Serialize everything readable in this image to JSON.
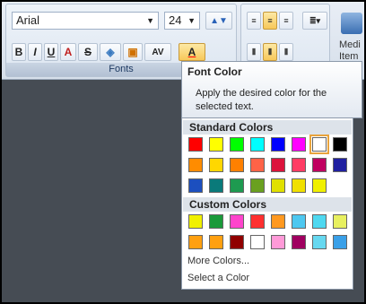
{
  "ribbon": {
    "fonts_group_label": "Fonts",
    "font_family": "Arial",
    "font_size": "24",
    "buttons": {
      "bold": "B",
      "italic": "I",
      "underline": "U",
      "strike": "S",
      "spacing": "AV",
      "font_color": "A"
    },
    "media_label_1": "Medi",
    "media_label_2": "Item"
  },
  "tooltip": {
    "title": "Font Color",
    "description": "Apply the desired color for the selected text."
  },
  "menu": {
    "standard_header": "Standard Colors",
    "custom_header": "Custom Colors",
    "more_colors": "More Colors...",
    "select_color": "Select a Color",
    "standard_colors": [
      "#ff0000",
      "#ffff00",
      "#00ff00",
      "#00ffff",
      "#0000ff",
      "#ff00ff",
      "#ffffff",
      "#000000",
      "#ff8c00",
      "#ffd700",
      "#ff8000",
      "#ff6347",
      "#dc143c",
      "#ff3c64",
      "#c00060",
      "#2020a0",
      "#1c4fbf",
      "#0a7a7a",
      "#1e9a50",
      "#6aa020",
      "#e0e000",
      "#f0e000",
      "#f0f000"
    ],
    "selected_index": 6,
    "custom_colors": [
      "#f0f000",
      "#1a9a3a",
      "#ff44cc",
      "#ff3030",
      "#ff9920",
      "#4ec8f0",
      "#4ed8f0",
      "#e8f060",
      "#ffa010",
      "#ffa010",
      "#900000",
      "#ffffff",
      "#ff9ad8",
      "#a00060",
      "#66d8f0",
      "#3aa0e8"
    ]
  }
}
